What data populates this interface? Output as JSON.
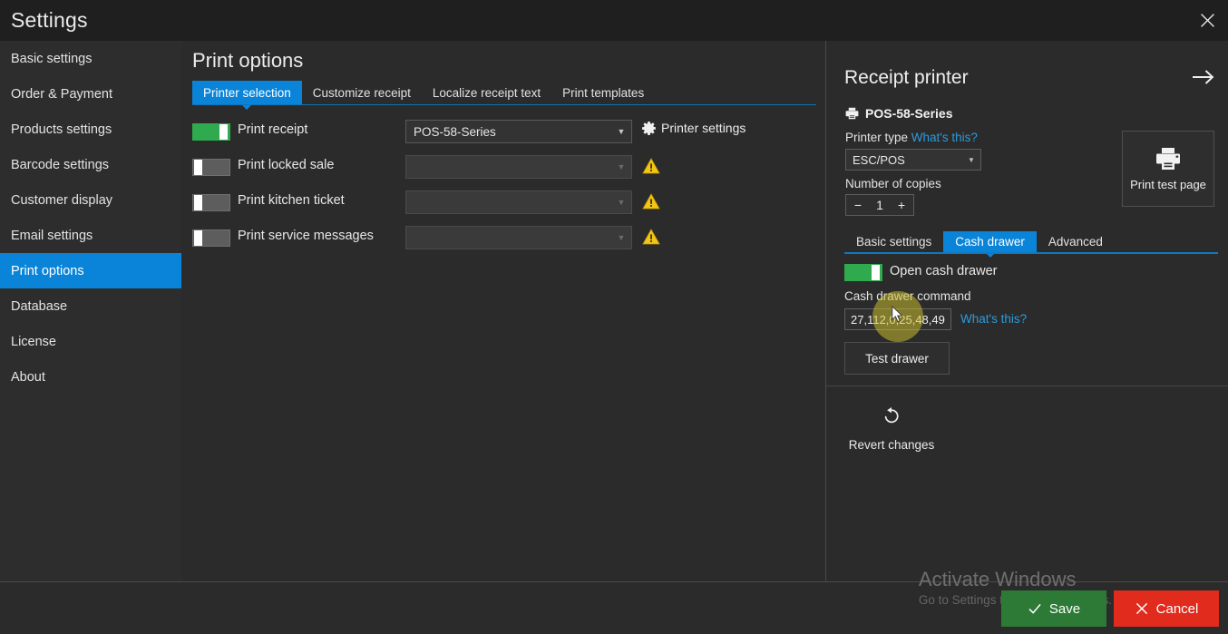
{
  "window": {
    "title": "Settings",
    "close_icon": "close-icon"
  },
  "colors": {
    "accent_blue": "#0a84d8",
    "toggle_on_green": "#2faa4e",
    "warning_yellow": "#f2c518",
    "link_blue": "#2e9bdc",
    "save_green": "#2d7a37",
    "cancel_red": "#e02b1d",
    "window_bg": "#2b2b2b",
    "titlebar_bg": "#1f1f1f"
  },
  "sidebar": {
    "items": [
      {
        "label": "Basic settings",
        "active": false
      },
      {
        "label": "Order & Payment",
        "active": false
      },
      {
        "label": "Products settings",
        "active": false
      },
      {
        "label": "Barcode settings",
        "active": false
      },
      {
        "label": "Customer display",
        "active": false
      },
      {
        "label": "Email settings",
        "active": false
      },
      {
        "label": "Print options",
        "active": true
      },
      {
        "label": "Database",
        "active": false
      },
      {
        "label": "License",
        "active": false
      },
      {
        "label": "About",
        "active": false
      }
    ]
  },
  "main": {
    "page_title": "Print options",
    "tabs": [
      {
        "label": "Printer selection",
        "active": true
      },
      {
        "label": "Customize receipt",
        "active": false
      },
      {
        "label": "Localize receipt text",
        "active": false
      },
      {
        "label": "Print templates",
        "active": false
      }
    ],
    "printer_settings_link": "Printer settings",
    "rows": [
      {
        "label": "Print receipt",
        "toggle_on": true,
        "combo_value": "POS-58-Series",
        "combo_disabled": false,
        "has_warning": false
      },
      {
        "label": "Print locked sale",
        "toggle_on": false,
        "combo_value": "",
        "combo_disabled": true,
        "has_warning": true
      },
      {
        "label": "Print kitchen ticket",
        "toggle_on": false,
        "combo_value": "",
        "combo_disabled": true,
        "has_warning": true
      },
      {
        "label": "Print service messages",
        "toggle_on": false,
        "combo_value": "",
        "combo_disabled": true,
        "has_warning": true
      }
    ]
  },
  "right_panel": {
    "title": "Receipt printer",
    "forward_arrow_icon": "arrow-right-icon",
    "device_icon": "printer-icon",
    "device_name": "POS-58-Series",
    "printer_type_label": "Printer type",
    "printer_type_help": "What's this?",
    "printer_type_value": "ESC/POS",
    "copies_label": "Number of copies",
    "copies_value": "1",
    "copies_minus": "−",
    "copies_plus": "+",
    "test_page_button": "Print test page",
    "test_page_icon": "printer-icon",
    "subtabs": [
      {
        "label": "Basic settings",
        "active": false
      },
      {
        "label": "Cash drawer",
        "active": true
      },
      {
        "label": "Advanced",
        "active": false
      }
    ],
    "open_cash_drawer_label": "Open cash drawer",
    "open_cash_drawer_on": true,
    "cash_drawer_command_label": "Cash drawer command",
    "cash_drawer_command_value": "27,112,0,25,48,49",
    "cash_drawer_help": "What's this?",
    "test_drawer_button": "Test drawer",
    "revert_label": "Revert changes",
    "revert_icon": "undo-icon"
  },
  "bottom_bar": {
    "save_label": "Save",
    "save_icon": "check-icon",
    "cancel_label": "Cancel",
    "cancel_icon": "close-icon",
    "watermark_title": "Activate Windows",
    "watermark_subtitle": "Go to Settings to activate Windows."
  }
}
